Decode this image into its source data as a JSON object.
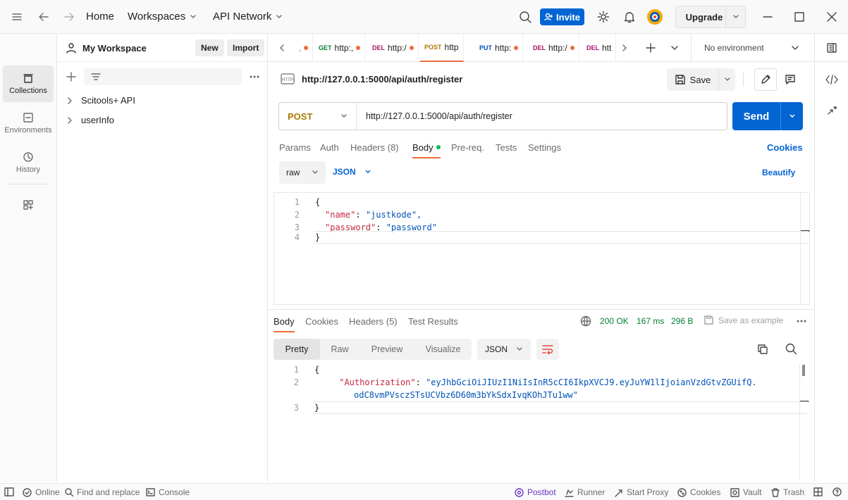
{
  "header": {
    "home": "Home",
    "workspaces": "Workspaces",
    "api_network": "API Network",
    "invite": "Invite",
    "upgrade": "Upgrade"
  },
  "rail": {
    "items": [
      {
        "label": "Collections",
        "icon": "collections-icon"
      },
      {
        "label": "Environments",
        "icon": "environments-icon"
      },
      {
        "label": "History",
        "icon": "history-icon"
      }
    ]
  },
  "sidebar": {
    "workspace": "My Workspace",
    "new": "New",
    "import": "Import",
    "tree": [
      "Scitools+ API",
      "userInfo"
    ]
  },
  "tabs": [
    {
      "method": "GET",
      "label": "http:,"
    },
    {
      "method": "DEL",
      "label": "http:/"
    },
    {
      "method": "POST",
      "label": "http"
    },
    {
      "method": "PUT",
      "label": "http:"
    },
    {
      "method": "DEL",
      "label": "http:/"
    },
    {
      "method": "DEL",
      "label": "htt"
    }
  ],
  "environment": "No environment",
  "request": {
    "title": "http://127.0.0.1:5000/api/auth/register",
    "save": "Save",
    "method": "POST",
    "url": "http://127.0.0.1:5000/api/auth/register",
    "send": "Send",
    "tabs": [
      "Params",
      "Auth",
      "Headers (8)",
      "Body",
      "Pre-req.",
      "Tests",
      "Settings"
    ],
    "active_tab": "Body",
    "cookies": "Cookies",
    "body_mode": "raw",
    "body_lang": "JSON",
    "beautify": "Beautify",
    "body_lines": [
      {
        "n": "1",
        "text": "{"
      },
      {
        "n": "2",
        "key": "\"name\"",
        "val": "\"justkode\","
      },
      {
        "n": "3",
        "key": "\"password\"",
        "val": "\"password\""
      },
      {
        "n": "4",
        "text": "}"
      }
    ]
  },
  "response": {
    "tabs": [
      "Body",
      "Cookies",
      "Headers (5)",
      "Test Results"
    ],
    "status": "200 OK",
    "time": "167 ms",
    "size": "296 B",
    "save_example": "Save as example",
    "views": [
      "Pretty",
      "Raw",
      "Preview",
      "Visualize"
    ],
    "lang": "JSON",
    "lines": [
      {
        "n": "1",
        "text": "{"
      },
      {
        "n": "2",
        "key": "\"Authorization\"",
        "val": "\"eyJhbGciOiJIUzI1NiIsInR5cCI6IkpXVCJ9.eyJuYW1lIjoianVzdGtvZGUifQ.",
        "val2": "odC8vmPVsczSTsUCVbz6D60m3bYkSdxIvqKOhJTu1ww\""
      },
      {
        "n": "3",
        "text": "}"
      }
    ]
  },
  "statusbar": {
    "online": "Online",
    "find": "Find and replace",
    "console": "Console",
    "postbot": "Postbot",
    "runner": "Runner",
    "proxy": "Start Proxy",
    "cookies": "Cookies",
    "vault": "Vault",
    "trash": "Trash"
  },
  "colors": {
    "accent": "#0265d2",
    "status_ok": "#007f31",
    "tab_underline": "#f26b3a"
  }
}
